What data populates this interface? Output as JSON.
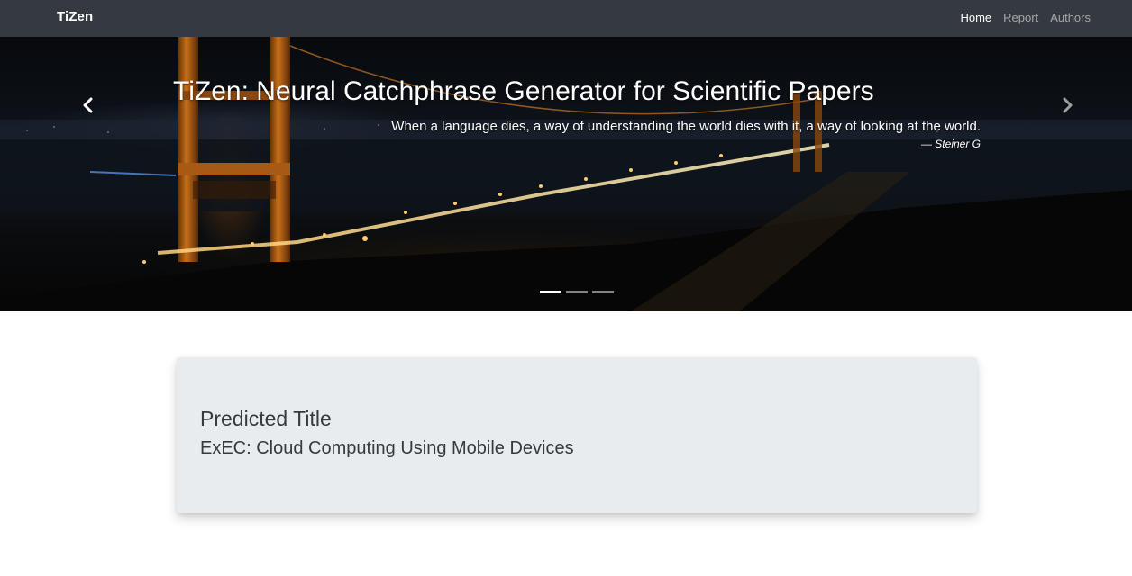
{
  "navbar": {
    "brand": "TiZen",
    "items": [
      {
        "label": "Home",
        "active": true
      },
      {
        "label": "Report",
        "active": false
      },
      {
        "label": "Authors",
        "active": false
      }
    ]
  },
  "hero": {
    "title": "TiZen: Neural Catchphrase Generator for Scientific Papers",
    "quote": "When a language dies, a way of understanding the world dies with it, a way of looking at the world.",
    "quote_author": "— Steiner G",
    "prev_icon": "chevron-left-icon",
    "next_icon": "chevron-right-icon",
    "slide_count": 3,
    "active_slide": 1
  },
  "card": {
    "label": "Predicted Title",
    "value": "ExEC: Cloud Computing Using Mobile Devices"
  },
  "colors": {
    "navbar_bg": "#343a40",
    "card_bg": "#e9ecef",
    "text_dark": "#343a40"
  }
}
